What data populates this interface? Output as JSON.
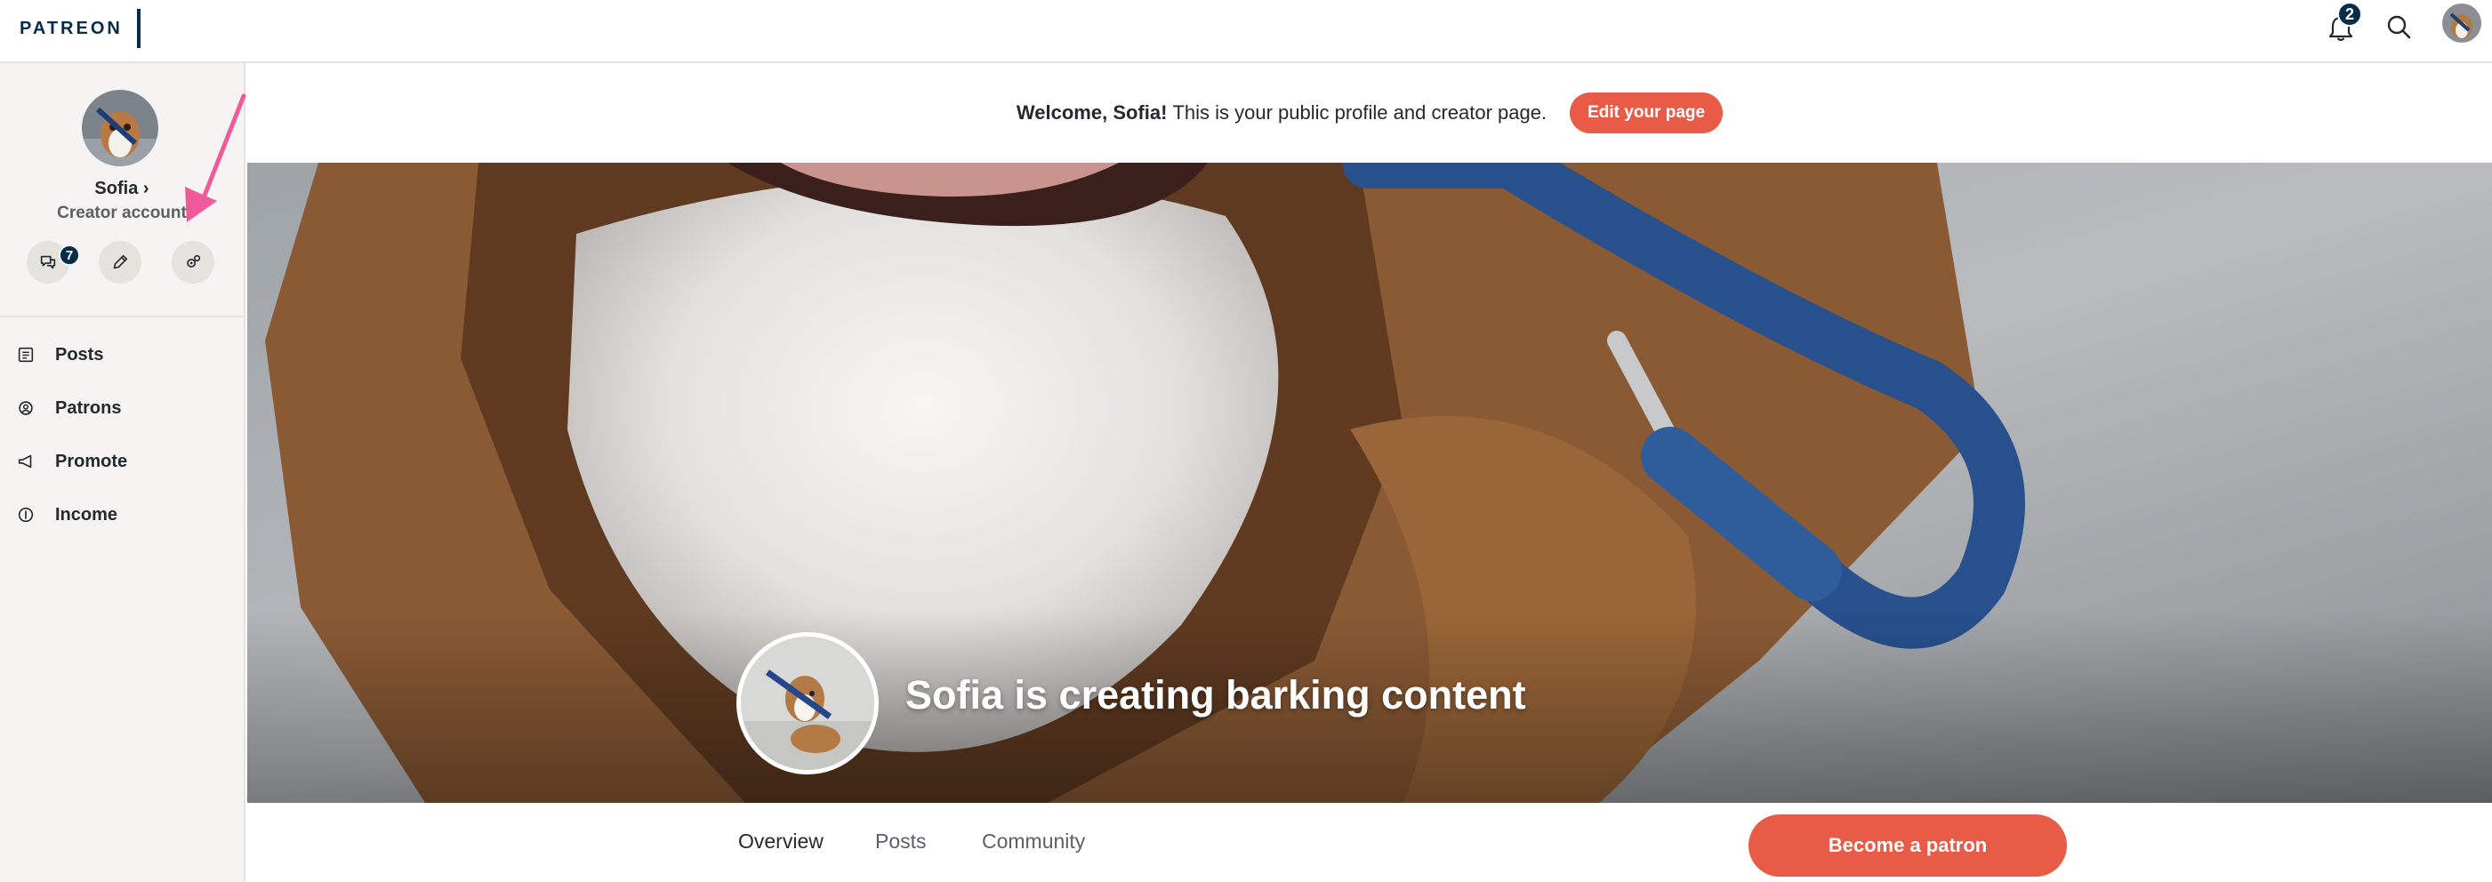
{
  "app": {
    "logo_text": "PATREON"
  },
  "header": {
    "notification_count": "2",
    "icons": [
      "bell-icon",
      "search-icon",
      "avatar"
    ]
  },
  "sidebar": {
    "name": "Sofia",
    "name_chevron": "›",
    "role": "Creator account",
    "message_badge": "7",
    "action_icons": [
      "chat-icon",
      "pencil-icon",
      "settings-gear-icon"
    ],
    "nav": [
      {
        "label": "Posts",
        "icon": "posts-icon"
      },
      {
        "label": "Patrons",
        "icon": "patrons-icon"
      },
      {
        "label": "Promote",
        "icon": "megaphone-icon"
      },
      {
        "label": "Income",
        "icon": "dollar-icon"
      }
    ]
  },
  "welcome": {
    "greeting": "Welcome, Sofia!",
    "message": "This is your public profile and creator page.",
    "edit_button": "Edit your page"
  },
  "cover": {
    "title": "Sofia is creating barking content"
  },
  "tabs": [
    {
      "label": "Overview",
      "active": true
    },
    {
      "label": "Posts",
      "active": false
    },
    {
      "label": "Community",
      "active": false
    }
  ],
  "cta": {
    "label": "Become a patron"
  },
  "colors": {
    "brand_navy": "#052d49",
    "accent_coral": "#e85b46",
    "annotation_pink": "#f0599a",
    "sidebar_bg": "#f5f4f2"
  }
}
